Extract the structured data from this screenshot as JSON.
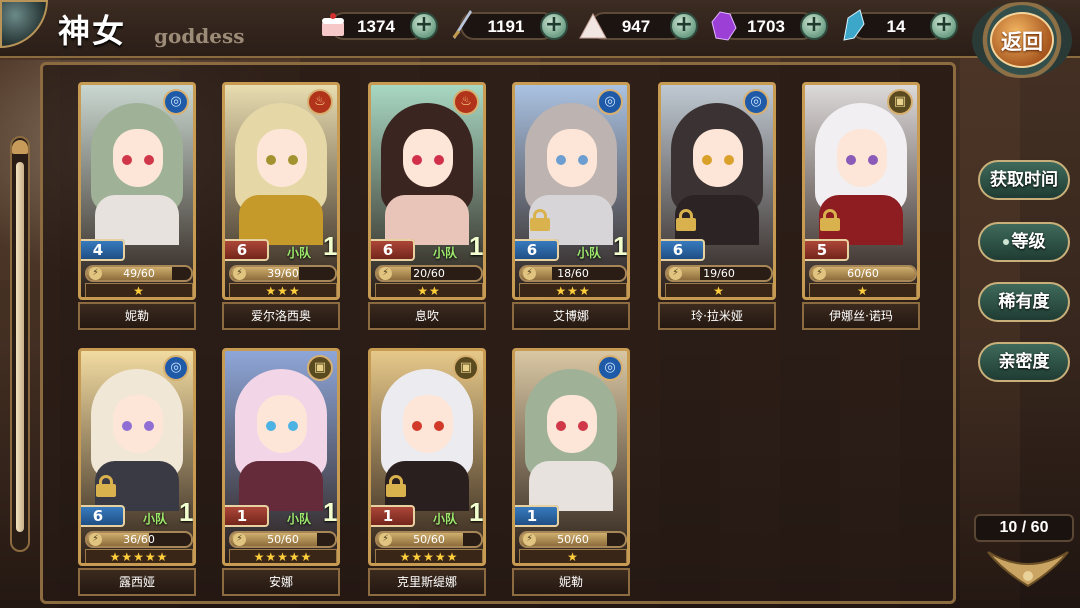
{
  "header": {
    "title": "神女",
    "subtitle": "goddess",
    "back_label": "返回"
  },
  "resources": [
    {
      "icon": "cake-icon",
      "value": "1374"
    },
    {
      "icon": "sword-icon",
      "value": "1191"
    },
    {
      "icon": "crystal-pile-icon",
      "value": "947"
    },
    {
      "icon": "purple-crystal-icon",
      "value": "1703"
    },
    {
      "icon": "feather-crystal-icon",
      "value": "14"
    }
  ],
  "sort_buttons": [
    "获取时间",
    "等级",
    "稀有度",
    "亲密度"
  ],
  "count": "10 / 60",
  "squad_label": "小队",
  "colors": {
    "water": "#1f5aa8",
    "fire": "#b0331a",
    "earth": "#5a4a1f",
    "star": "#ffce3b"
  },
  "cards": [
    {
      "name": "妮勒",
      "level": "4",
      "exp": "49/60",
      "exp_fraction": 0.82,
      "stars": "★",
      "element": "water",
      "locked": false,
      "squad": "",
      "lvcolor": "blue"
    },
    {
      "name": "爱尔洛西奥",
      "level": "6",
      "exp": "39/60",
      "exp_fraction": 0.65,
      "stars": "★★★",
      "element": "fire",
      "locked": false,
      "squad": "1",
      "lvcolor": "red"
    },
    {
      "name": "息吹",
      "level": "6",
      "exp": "20/60",
      "exp_fraction": 0.33,
      "stars": "★★",
      "element": "fire",
      "locked": false,
      "squad": "1",
      "lvcolor": "red"
    },
    {
      "name": "艾博娜",
      "level": "6",
      "exp": "18/60",
      "exp_fraction": 0.3,
      "stars": "★★★",
      "element": "water",
      "locked": true,
      "squad": "1",
      "lvcolor": "blue"
    },
    {
      "name": "玲·拉米娅",
      "level": "6",
      "exp": "19/60",
      "exp_fraction": 0.32,
      "stars": "★",
      "element": "water",
      "locked": true,
      "squad": "",
      "lvcolor": "blue"
    },
    {
      "name": "伊娜丝·诺玛",
      "level": "5",
      "exp": "60/60",
      "exp_fraction": 1.0,
      "stars": "★",
      "element": "earth",
      "locked": true,
      "squad": "",
      "lvcolor": "red"
    },
    {
      "name": "露西娅",
      "level": "6",
      "exp": "36/60",
      "exp_fraction": 0.6,
      "stars": "★★★★★",
      "element": "water",
      "locked": true,
      "squad": "1",
      "lvcolor": "blue"
    },
    {
      "name": "安娜",
      "level": "1",
      "exp": "50/60",
      "exp_fraction": 0.83,
      "stars": "★★★★★",
      "element": "earth",
      "locked": false,
      "squad": "1",
      "lvcolor": "red"
    },
    {
      "name": "克里斯缇娜",
      "level": "1",
      "exp": "50/60",
      "exp_fraction": 0.83,
      "stars": "★★★★★",
      "element": "earth",
      "locked": true,
      "squad": "1",
      "lvcolor": "red"
    },
    {
      "name": "妮勒",
      "level": "1",
      "exp": "50/60",
      "exp_fraction": 0.83,
      "stars": "★",
      "element": "water",
      "locked": false,
      "squad": "",
      "lvcolor": "blue"
    }
  ]
}
